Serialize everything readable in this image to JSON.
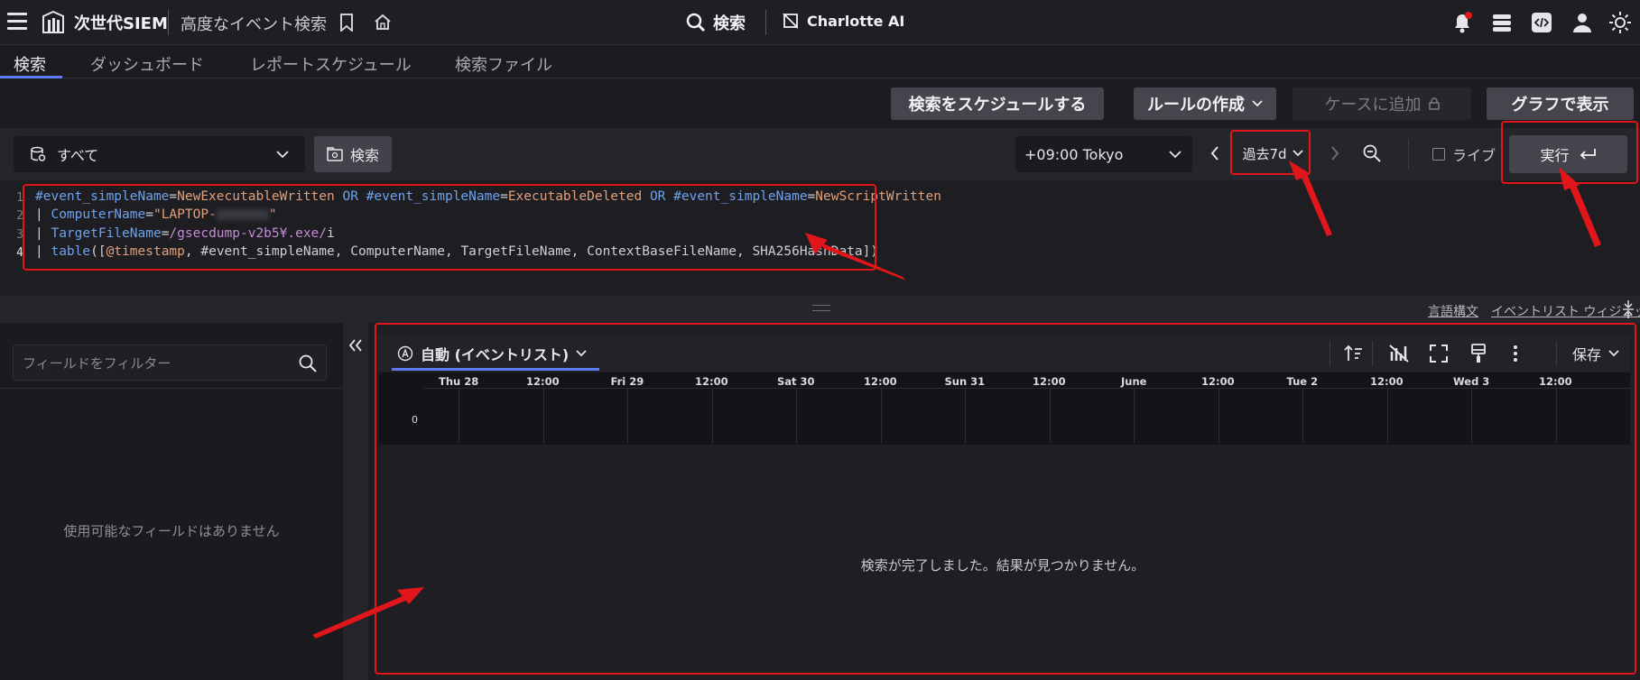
{
  "topbar": {
    "brand": "次世代SIEM",
    "crumb": "高度なイベント検索",
    "search_label": "検索",
    "charlotte_label": "Charlotte AI"
  },
  "tabs": [
    {
      "label": "検索",
      "active": true
    },
    {
      "label": "ダッシュボード"
    },
    {
      "label": "レポートスケジュール"
    },
    {
      "label": "検索ファイル"
    }
  ],
  "actions": {
    "schedule": "検索をスケジュールする",
    "create_rule": "ルールの作成",
    "add_case": "ケースに追加",
    "graph": "グラフで表示"
  },
  "query_bar": {
    "repo": "すべて",
    "search": "検索",
    "timezone": "+09:00 Tokyo",
    "time_range": "過去7d",
    "live": "ライブ",
    "run": "実行"
  },
  "editor": {
    "line_numbers": [
      "1",
      "2",
      "3",
      "4"
    ],
    "l1": {
      "k1": "#event_simpleName",
      "eq": "=",
      "v1": "NewExecutableWritten",
      "or1": " OR ",
      "k2": "#event_simpleName",
      "v2": "ExecutableDeleted",
      "or2": " OR ",
      "k3": "#event_simpleName",
      "v3": "NewScriptWritten"
    },
    "l2": {
      "pipe": "| ",
      "key": "ComputerName",
      "val_start": "\"LAPTOP-",
      "val_end": "\""
    },
    "l3": {
      "pipe": "| ",
      "key": "TargetFileName",
      "re": "/gsecdump-v2b5¥.exe/",
      "flag": "i"
    },
    "l4": {
      "pipe": "| ",
      "fn": "table",
      "open": "([",
      "f1": "@timestamp",
      "rest": ", #event_simpleName, ComputerName, TargetFileName, ContextBaseFileName, SHA256HashData",
      "close": "])"
    }
  },
  "midrow": {
    "syntax_link": "言語構文",
    "widget_link": "イベントリスト ウィジェット"
  },
  "left_panel": {
    "filter_placeholder": "フィールドをフィルター",
    "empty_text": "使用可能なフィールドはありません"
  },
  "results": {
    "widget": "自動 (イベントリスト)",
    "save": "保存",
    "timeline_labels": [
      "Thu 28",
      "12:00",
      "Fri 29",
      "12:00",
      "Sat 30",
      "12:00",
      "Sun 31",
      "12:00",
      "June",
      "12:00",
      "Tue 2",
      "12:00",
      "Wed 3",
      "12:00"
    ],
    "y_zero": "0",
    "message": "検索が完了しました。結果が見つかりません。"
  },
  "colors": {
    "accent": "#5d7bf3",
    "annotation": "#e0161a",
    "notification_dot": "#e0161a"
  }
}
